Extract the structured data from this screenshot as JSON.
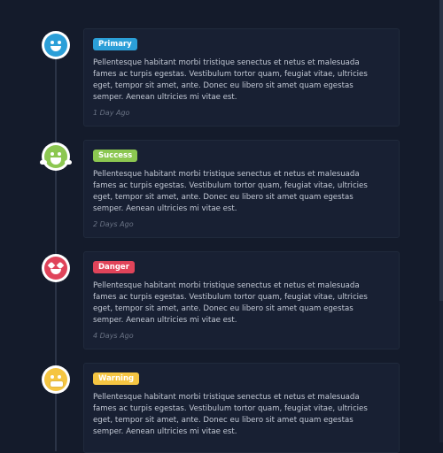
{
  "timeline": {
    "events": [
      {
        "badge": "Primary",
        "badge_color": "#2b9fd8",
        "avatar_icon": "smile-emoji-icon",
        "avatar_color": "#2b9fd8",
        "text": "Pellentesque habitant morbi tristique senectus et netus et malesuada fames ac turpis egestas. Vestibulum tortor quam, feugiat vitae, ultricies eget, tempor sit amet, ante. Donec eu libero sit amet quam egestas semper. Aenean ultricies mi vitae est.",
        "time": "1 Day Ago"
      },
      {
        "badge": "Success",
        "badge_color": "#8cc751",
        "avatar_icon": "laughing-emoji-icon",
        "avatar_color": "#8cc751",
        "text": "Pellentesque habitant morbi tristique senectus et netus et malesuada fames ac turpis egestas. Vestibulum tortor quam, feugiat vitae, ultricies eget, tempor sit amet, ante. Donec eu libero sit amet quam egestas semper. Aenean ultricies mi vitae est.",
        "time": "2 Days Ago"
      },
      {
        "badge": "Danger",
        "badge_color": "#e0445a",
        "avatar_icon": "heart-eyes-emoji-icon",
        "avatar_color": "#e0445a",
        "text": "Pellentesque habitant morbi tristique senectus et netus et malesuada fames ac turpis egestas. Vestibulum tortor quam, feugiat vitae, ultricies eget, tempor sit amet, ante. Donec eu libero sit amet quam egestas semper. Aenean ultricies mi vitae est.",
        "time": "4 Days Ago"
      },
      {
        "badge": "Warning",
        "badge_color": "#f5c542",
        "avatar_icon": "grimace-emoji-icon",
        "avatar_color": "#f5c542",
        "text": "Pellentesque habitant morbi tristique senectus et netus et malesuada fames ac turpis egestas. Vestibulum tortor quam, feugiat vitae, ultricies eget, tempor sit amet, ante. Donec eu libero sit amet quam egestas semper. Aenean ultricies mi vitae est.",
        "time": ""
      }
    ]
  }
}
